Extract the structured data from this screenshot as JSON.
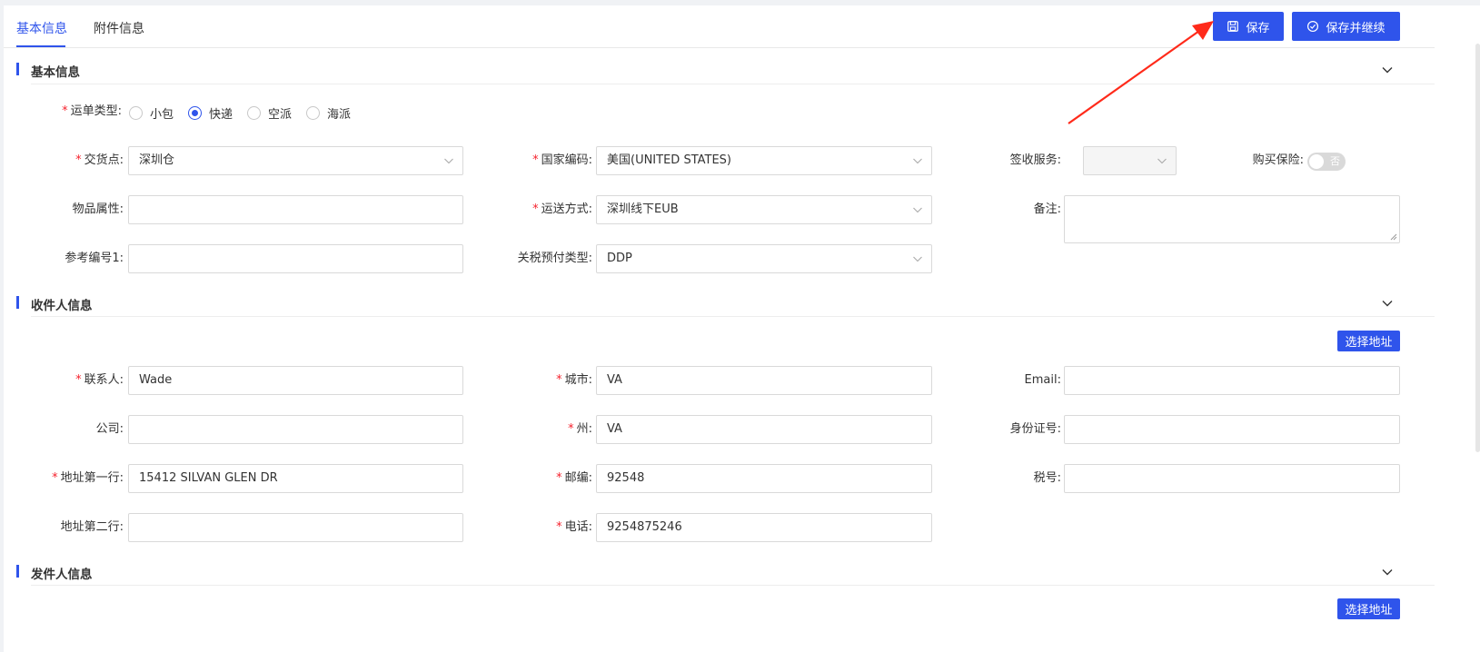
{
  "tabs": [
    {
      "label": "基本信息",
      "active": true
    },
    {
      "label": "附件信息",
      "active": false
    }
  ],
  "toolbar": {
    "save_label": "保存",
    "save_continue_label": "保存并继续",
    "save_icon": "floppy-disk-icon",
    "save_continue_icon": "check-circle-icon"
  },
  "colors": {
    "primary": "#2f54eb",
    "required": "#f5222d",
    "annotation_arrow": "#ff2a1a"
  },
  "basic": {
    "title": "基本信息",
    "waybill_type": {
      "label": "运单类型:",
      "options": [
        "小包",
        "快递",
        "空派",
        "海派"
      ],
      "selected": "快递"
    },
    "delivery_point": {
      "label": "交货点:",
      "value": "深圳仓"
    },
    "country_code": {
      "label": "国家编码:",
      "value": "美国(UNITED STATES)"
    },
    "sign_service": {
      "label": "签收服务:",
      "value": ""
    },
    "buy_insurance": {
      "label": "购买保险:",
      "value": "否"
    },
    "item_property": {
      "label": "物品属性:",
      "value": ""
    },
    "shipping_method": {
      "label": "运送方式:",
      "value": "深圳线下EUB"
    },
    "remark": {
      "label": "备注:",
      "value": ""
    },
    "reference_no1": {
      "label": "参考编号1:",
      "value": ""
    },
    "duty_prepay_type": {
      "label": "关税预付类型:",
      "value": "DDP"
    }
  },
  "recipient": {
    "title": "收件人信息",
    "select_address_label": "选择地址",
    "contact": {
      "label": "联系人:",
      "value": "Wade"
    },
    "city": {
      "label": "城市:",
      "value": "VA"
    },
    "email": {
      "label": "Email:",
      "value": ""
    },
    "company": {
      "label": "公司:",
      "value": ""
    },
    "state": {
      "label": "州:",
      "value": "VA"
    },
    "id_number": {
      "label": "身份证号:",
      "value": ""
    },
    "address1": {
      "label": "地址第一行:",
      "value": "15412 SILVAN GLEN DR"
    },
    "postcode": {
      "label": "邮编:",
      "value": "92548"
    },
    "tax_no": {
      "label": "税号:",
      "value": ""
    },
    "address2": {
      "label": "地址第二行:",
      "value": ""
    },
    "phone": {
      "label": "电话:",
      "value": "9254875246"
    }
  },
  "sender": {
    "title": "发件人信息",
    "select_address_label": "选择地址"
  }
}
